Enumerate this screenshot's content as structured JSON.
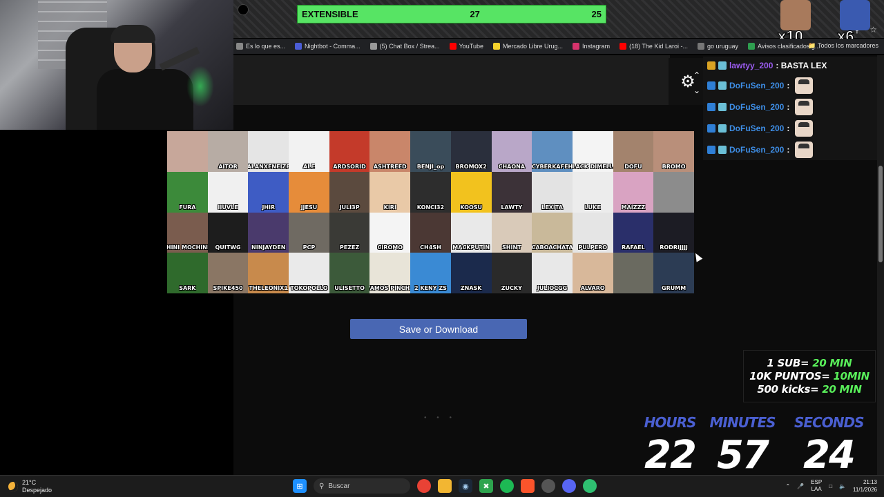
{
  "goal": {
    "label": "EXTENSIBLE",
    "current": "27",
    "target": "25",
    "fill": 1.0
  },
  "emote_badges": [
    {
      "multiplier": "x10"
    },
    {
      "multiplier": "x6"
    }
  ],
  "bookmarks": [
    {
      "label": "Es lo que es...",
      "color": "#888888"
    },
    {
      "label": "Nightbot - Comma...",
      "color": "#4b5dd6"
    },
    {
      "label": "(5) Chat Box / Strea...",
      "color": "#999999"
    },
    {
      "label": "YouTube",
      "color": "#ff0000"
    },
    {
      "label": "Mercado Libre Urug...",
      "color": "#f4d12c"
    },
    {
      "label": "Instagram",
      "color": "#d6336c"
    },
    {
      "label": "(18) The Kid Laroi -...",
      "color": "#ff0000"
    },
    {
      "label": "go uruguay",
      "color": "#777777"
    },
    {
      "label": "Avisos clasificados g...",
      "color": "#2e9e4f"
    }
  ],
  "bookmarks_folder": "Todos los marcadores",
  "chat": [
    {
      "user": "lawtyy_200",
      "message": ": BASTA LEX",
      "color": "purple",
      "emote": false
    },
    {
      "user": "DoFuSen_200",
      "message": ":",
      "color": "blue",
      "emote": true
    },
    {
      "user": "DoFuSen_200",
      "message": ":",
      "color": "blue",
      "emote": true
    },
    {
      "user": "DoFuSen_200",
      "message": ":",
      "color": "blue",
      "emote": true
    },
    {
      "user": "DoFuSen_200",
      "message": ":",
      "color": "blue",
      "emote": true
    }
  ],
  "tiles": [
    {
      "name": "",
      "bg": "#c7a79a"
    },
    {
      "name": "AITOR",
      "bg": "#b7aca4"
    },
    {
      "name": "ALANXENEIZE",
      "bg": "#e5e5e5"
    },
    {
      "name": "ALE",
      "bg": "#f2f2f2"
    },
    {
      "name": "ARDSORID",
      "bg": "#c43a2a"
    },
    {
      "name": "ASHTREED",
      "bg": "#c9866a"
    },
    {
      "name": "BENJI_op",
      "bg": "#3a4c5a"
    },
    {
      "name": "BROMOX2",
      "bg": "#2a2f3c"
    },
    {
      "name": "CHAONA",
      "bg": "#b9a7c8"
    },
    {
      "name": "CYBERKAFEH",
      "bg": "#5f8fc0"
    },
    {
      "name": "BLACK DIMELLA",
      "bg": "#f4f4f4"
    },
    {
      "name": "DOFU",
      "bg": "#a3836d"
    },
    {
      "name": "BROMO",
      "bg": "#b98f7a"
    },
    {
      "name": "FURA",
      "bg": "#3c8a3a"
    },
    {
      "name": "IIUVLE",
      "bg": "#f0f0f0"
    },
    {
      "name": "JHIR",
      "bg": "#3e5cc4"
    },
    {
      "name": "JJESU",
      "bg": "#e68c3a"
    },
    {
      "name": "JULI3P",
      "bg": "#5b4a3e"
    },
    {
      "name": "KIRI",
      "bg": "#e9c9a7"
    },
    {
      "name": "KONCI32",
      "bg": "#2d2d2d"
    },
    {
      "name": "KOOSU",
      "bg": "#f2c21e"
    },
    {
      "name": "LAWTY",
      "bg": "#3c3238"
    },
    {
      "name": "LEXITA",
      "bg": "#e3e3e3"
    },
    {
      "name": "LUKE",
      "bg": "#ececec"
    },
    {
      "name": "MAIZZZ",
      "bg": "#d9a3c2"
    },
    {
      "name": "",
      "bg": "#8c8c8c"
    },
    {
      "name": "COCHINI MOCHINICRY",
      "bg": "#7a5c4e"
    },
    {
      "name": "QUITWG",
      "bg": "#1d1d1d"
    },
    {
      "name": "NINJAYDEN",
      "bg": "#4a3a6c"
    },
    {
      "name": "PCP",
      "bg": "#6f6a62"
    },
    {
      "name": "PEZEZ",
      "bg": "#3a3a36"
    },
    {
      "name": "CIROMO",
      "bg": "#f4f4f4"
    },
    {
      "name": "CH4SH",
      "bg": "#4b3834"
    },
    {
      "name": "MACKPUTIN",
      "bg": "#e9e9e9"
    },
    {
      "name": "SHINT",
      "bg": "#d9cab9"
    },
    {
      "name": "CABOACHATA",
      "bg": "#c9b99a"
    },
    {
      "name": "PULPERO",
      "bg": "#e5e5e5"
    },
    {
      "name": "RAFAEL",
      "bg": "#2a2f6a"
    },
    {
      "name": "RODRIJJJJ",
      "bg": "#1c1c24"
    },
    {
      "name": "SARK",
      "bg": "#2f6a2c"
    },
    {
      "name": "SPIKE450",
      "bg": "#8a7664"
    },
    {
      "name": "THELEONIX1",
      "bg": "#c88a4c"
    },
    {
      "name": "TOKOPOLLO",
      "bg": "#eaeaea"
    },
    {
      "name": "ULISETTO",
      "bg": "#3c5a3a"
    },
    {
      "name": "VAMOS PINCHA",
      "bg": "#e8e4d8"
    },
    {
      "name": "2 KENY ZS",
      "bg": "#3a8ad4"
    },
    {
      "name": "ZNASK",
      "bg": "#1b2a4c"
    },
    {
      "name": "ZUCKY",
      "bg": "#2a2a2a"
    },
    {
      "name": "JULIOCGG",
      "bg": "#e8e8e8"
    },
    {
      "name": "ALVARO",
      "bg": "#d8b89a"
    },
    {
      "name": "",
      "bg": "#6a6a60"
    },
    {
      "name": "GRUMM",
      "bg": "#2c3c54"
    }
  ],
  "save_button": "Save or Download",
  "loading": "• • •",
  "promo": [
    {
      "white": "1 SUB= ",
      "green": "20 MIN"
    },
    {
      "white": "10K PUNTOS= ",
      "green": "10MIN"
    },
    {
      "white": "500 kicks= ",
      "green": "20 MIN"
    }
  ],
  "timer": {
    "hours_label": "HOURS",
    "hours": "22",
    "minutes_label": "MINUTES",
    "minutes": "57",
    "seconds_label": "SECONDS",
    "seconds": "24"
  },
  "taskbar": {
    "temp": "21°C",
    "weather": "Despejado",
    "search": "Buscar",
    "lang": "ESP",
    "layout": "LAA",
    "time": "21:13",
    "date": "11/1/2026"
  },
  "colors": {
    "accent_green": "#3ccb48",
    "button_blue": "#4967b3",
    "timer_blue": "#4a5fd1",
    "promo_green": "#59f05a"
  }
}
